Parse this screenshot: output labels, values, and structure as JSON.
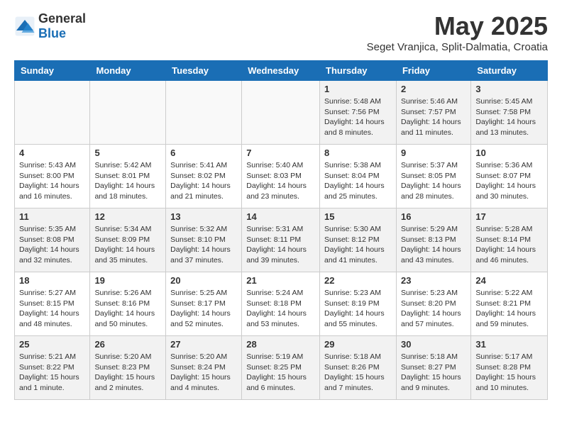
{
  "header": {
    "logo_general": "General",
    "logo_blue": "Blue",
    "title": "May 2025",
    "subtitle": "Seget Vranjica, Split-Dalmatia, Croatia"
  },
  "weekdays": [
    "Sunday",
    "Monday",
    "Tuesday",
    "Wednesday",
    "Thursday",
    "Friday",
    "Saturday"
  ],
  "weeks": [
    [
      {
        "date": "",
        "info": ""
      },
      {
        "date": "",
        "info": ""
      },
      {
        "date": "",
        "info": ""
      },
      {
        "date": "",
        "info": ""
      },
      {
        "date": "1",
        "info": "Sunrise: 5:48 AM\nSunset: 7:56 PM\nDaylight: 14 hours\nand 8 minutes."
      },
      {
        "date": "2",
        "info": "Sunrise: 5:46 AM\nSunset: 7:57 PM\nDaylight: 14 hours\nand 11 minutes."
      },
      {
        "date": "3",
        "info": "Sunrise: 5:45 AM\nSunset: 7:58 PM\nDaylight: 14 hours\nand 13 minutes."
      }
    ],
    [
      {
        "date": "4",
        "info": "Sunrise: 5:43 AM\nSunset: 8:00 PM\nDaylight: 14 hours\nand 16 minutes."
      },
      {
        "date": "5",
        "info": "Sunrise: 5:42 AM\nSunset: 8:01 PM\nDaylight: 14 hours\nand 18 minutes."
      },
      {
        "date": "6",
        "info": "Sunrise: 5:41 AM\nSunset: 8:02 PM\nDaylight: 14 hours\nand 21 minutes."
      },
      {
        "date": "7",
        "info": "Sunrise: 5:40 AM\nSunset: 8:03 PM\nDaylight: 14 hours\nand 23 minutes."
      },
      {
        "date": "8",
        "info": "Sunrise: 5:38 AM\nSunset: 8:04 PM\nDaylight: 14 hours\nand 25 minutes."
      },
      {
        "date": "9",
        "info": "Sunrise: 5:37 AM\nSunset: 8:05 PM\nDaylight: 14 hours\nand 28 minutes."
      },
      {
        "date": "10",
        "info": "Sunrise: 5:36 AM\nSunset: 8:07 PM\nDaylight: 14 hours\nand 30 minutes."
      }
    ],
    [
      {
        "date": "11",
        "info": "Sunrise: 5:35 AM\nSunset: 8:08 PM\nDaylight: 14 hours\nand 32 minutes."
      },
      {
        "date": "12",
        "info": "Sunrise: 5:34 AM\nSunset: 8:09 PM\nDaylight: 14 hours\nand 35 minutes."
      },
      {
        "date": "13",
        "info": "Sunrise: 5:32 AM\nSunset: 8:10 PM\nDaylight: 14 hours\nand 37 minutes."
      },
      {
        "date": "14",
        "info": "Sunrise: 5:31 AM\nSunset: 8:11 PM\nDaylight: 14 hours\nand 39 minutes."
      },
      {
        "date": "15",
        "info": "Sunrise: 5:30 AM\nSunset: 8:12 PM\nDaylight: 14 hours\nand 41 minutes."
      },
      {
        "date": "16",
        "info": "Sunrise: 5:29 AM\nSunset: 8:13 PM\nDaylight: 14 hours\nand 43 minutes."
      },
      {
        "date": "17",
        "info": "Sunrise: 5:28 AM\nSunset: 8:14 PM\nDaylight: 14 hours\nand 46 minutes."
      }
    ],
    [
      {
        "date": "18",
        "info": "Sunrise: 5:27 AM\nSunset: 8:15 PM\nDaylight: 14 hours\nand 48 minutes."
      },
      {
        "date": "19",
        "info": "Sunrise: 5:26 AM\nSunset: 8:16 PM\nDaylight: 14 hours\nand 50 minutes."
      },
      {
        "date": "20",
        "info": "Sunrise: 5:25 AM\nSunset: 8:17 PM\nDaylight: 14 hours\nand 52 minutes."
      },
      {
        "date": "21",
        "info": "Sunrise: 5:24 AM\nSunset: 8:18 PM\nDaylight: 14 hours\nand 53 minutes."
      },
      {
        "date": "22",
        "info": "Sunrise: 5:23 AM\nSunset: 8:19 PM\nDaylight: 14 hours\nand 55 minutes."
      },
      {
        "date": "23",
        "info": "Sunrise: 5:23 AM\nSunset: 8:20 PM\nDaylight: 14 hours\nand 57 minutes."
      },
      {
        "date": "24",
        "info": "Sunrise: 5:22 AM\nSunset: 8:21 PM\nDaylight: 14 hours\nand 59 minutes."
      }
    ],
    [
      {
        "date": "25",
        "info": "Sunrise: 5:21 AM\nSunset: 8:22 PM\nDaylight: 15 hours\nand 1 minute."
      },
      {
        "date": "26",
        "info": "Sunrise: 5:20 AM\nSunset: 8:23 PM\nDaylight: 15 hours\nand 2 minutes."
      },
      {
        "date": "27",
        "info": "Sunrise: 5:20 AM\nSunset: 8:24 PM\nDaylight: 15 hours\nand 4 minutes."
      },
      {
        "date": "28",
        "info": "Sunrise: 5:19 AM\nSunset: 8:25 PM\nDaylight: 15 hours\nand 6 minutes."
      },
      {
        "date": "29",
        "info": "Sunrise: 5:18 AM\nSunset: 8:26 PM\nDaylight: 15 hours\nand 7 minutes."
      },
      {
        "date": "30",
        "info": "Sunrise: 5:18 AM\nSunset: 8:27 PM\nDaylight: 15 hours\nand 9 minutes."
      },
      {
        "date": "31",
        "info": "Sunrise: 5:17 AM\nSunset: 8:28 PM\nDaylight: 15 hours\nand 10 minutes."
      }
    ]
  ]
}
